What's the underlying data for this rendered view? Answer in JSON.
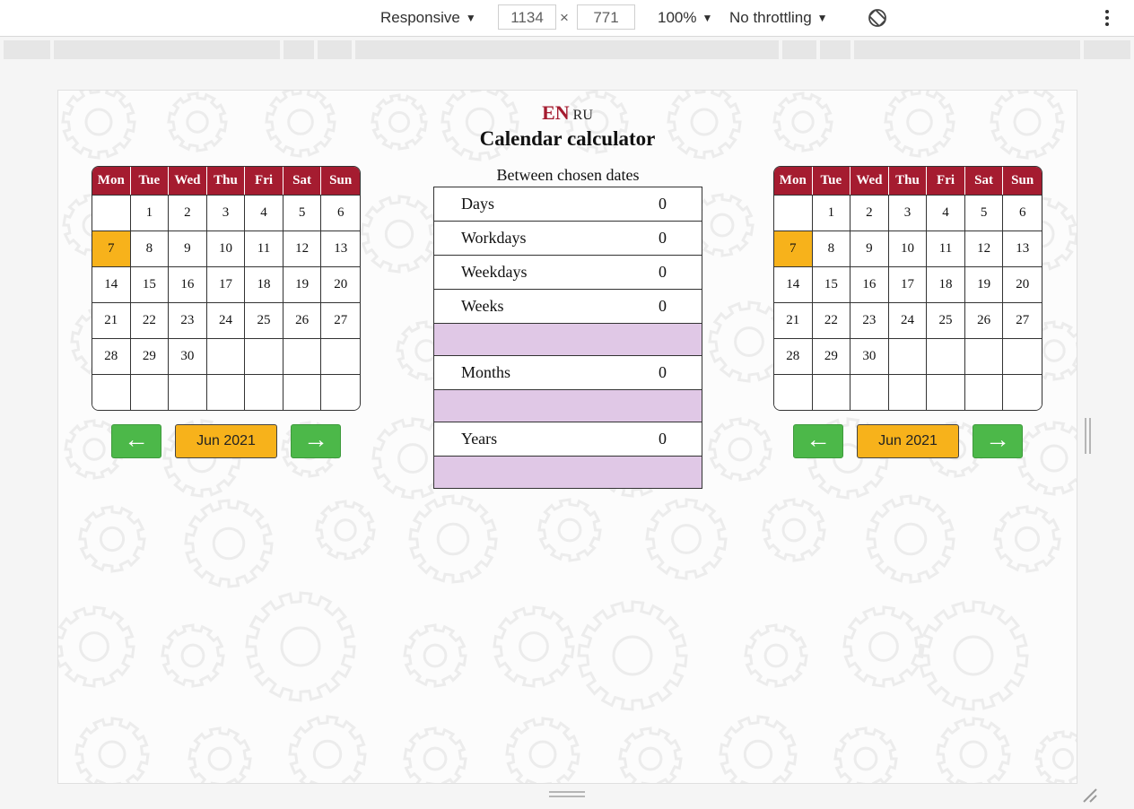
{
  "devtools": {
    "device_mode": "Responsive",
    "width_value": "1134",
    "times": "×",
    "height_value": "771",
    "zoom": "100%",
    "throttling": "No throttling",
    "icons": [
      "rotate-icon",
      "more-vertical-icon",
      "chevron-down-icon"
    ]
  },
  "page": {
    "lang_en": "EN",
    "lang_ru": "RU",
    "title": "Calendar calculator",
    "between_label": "Between chosen dates",
    "colors": {
      "header": "#a51c30",
      "today": "#f7b21b",
      "nav_button": "#4cb849",
      "month_button": "#f7b21b",
      "empty_row": "#e0c8e6"
    }
  },
  "calendar_left": {
    "weekdays": [
      "Mon",
      "Tue",
      "Wed",
      "Thu",
      "Fri",
      "Sat",
      "Sun"
    ],
    "weeks": [
      [
        "",
        "1",
        "2",
        "3",
        "4",
        "5",
        "6"
      ],
      [
        "7",
        "8",
        "9",
        "10",
        "11",
        "12",
        "13"
      ],
      [
        "14",
        "15",
        "16",
        "17",
        "18",
        "19",
        "20"
      ],
      [
        "21",
        "22",
        "23",
        "24",
        "25",
        "26",
        "27"
      ],
      [
        "28",
        "29",
        "30",
        "",
        "",
        "",
        ""
      ],
      [
        "",
        "",
        "",
        "",
        "",
        "",
        ""
      ]
    ],
    "highlighted_day": "7",
    "prev_label": "←",
    "month_label": "Jun 2021",
    "next_label": "→"
  },
  "calendar_right": {
    "weekdays": [
      "Mon",
      "Tue",
      "Wed",
      "Thu",
      "Fri",
      "Sat",
      "Sun"
    ],
    "weeks": [
      [
        "",
        "1",
        "2",
        "3",
        "4",
        "5",
        "6"
      ],
      [
        "7",
        "8",
        "9",
        "10",
        "11",
        "12",
        "13"
      ],
      [
        "14",
        "15",
        "16",
        "17",
        "18",
        "19",
        "20"
      ],
      [
        "21",
        "22",
        "23",
        "24",
        "25",
        "26",
        "27"
      ],
      [
        "28",
        "29",
        "30",
        "",
        "",
        "",
        ""
      ],
      [
        "",
        "",
        "",
        "",
        "",
        "",
        ""
      ]
    ],
    "highlighted_day": "7",
    "prev_label": "←",
    "month_label": "Jun 2021",
    "next_label": "→"
  },
  "results": {
    "days": {
      "label": "Days",
      "value": "0"
    },
    "workdays": {
      "label": "Workdays",
      "value": "0"
    },
    "weekdays": {
      "label": "Weekdays",
      "value": "0"
    },
    "weeks": {
      "label": "Weeks",
      "value": "0"
    },
    "months": {
      "label": "Months",
      "value": "0"
    },
    "years": {
      "label": "Years",
      "value": "0"
    }
  }
}
